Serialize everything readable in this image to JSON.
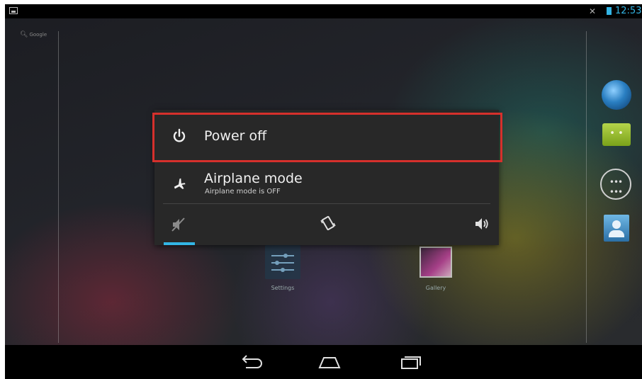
{
  "status_bar": {
    "time": "12:53",
    "icons": [
      "screenshot-icon",
      "mute-icon",
      "battery-icon"
    ],
    "accent_color": "#33b5e5"
  },
  "home": {
    "search_label": "Google",
    "apps": [
      {
        "label": "Settings",
        "icon": "settings-icon"
      },
      {
        "label": "Gallery",
        "icon": "gallery-icon"
      }
    ],
    "dock_icons": [
      "browser-globe-icon",
      "messaging-icon",
      "app-drawer-icon",
      "people-icon"
    ]
  },
  "power_dialog": {
    "items": [
      {
        "label": "Power off",
        "icon": "power-icon",
        "highlighted": true
      },
      {
        "label": "Airplane mode",
        "sublabel": "Airplane mode is OFF",
        "icon": "airplane-icon"
      }
    ],
    "sound_modes": [
      {
        "mode": "silent",
        "icon": "silent-icon",
        "selected": true
      },
      {
        "mode": "vibrate",
        "icon": "vibrate-icon",
        "selected": false
      },
      {
        "mode": "sound",
        "icon": "sound-on-icon",
        "selected": false
      }
    ],
    "highlight_color": "#d6302c"
  },
  "nav_bar": {
    "buttons": [
      "back-icon",
      "home-icon",
      "recent-apps-icon"
    ]
  }
}
